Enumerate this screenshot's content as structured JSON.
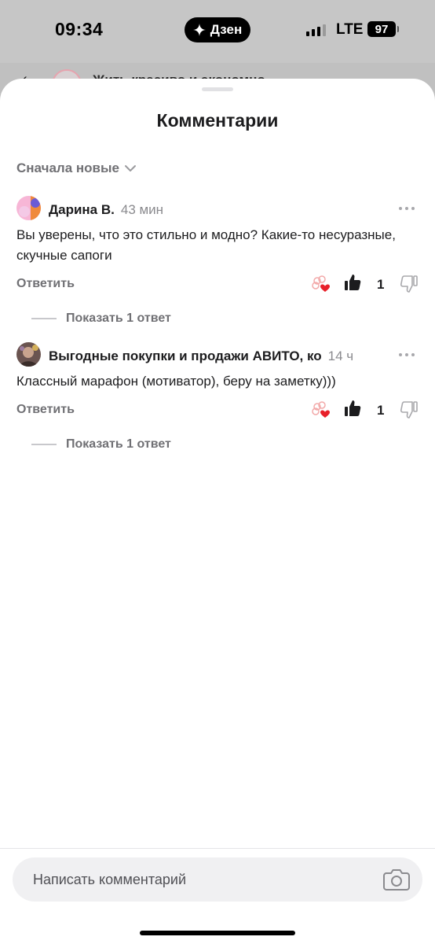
{
  "status_bar": {
    "time": "09:34",
    "app_pill": "Дзен",
    "network": "LTE",
    "battery": "97"
  },
  "background": {
    "title": "Жить красиво и экономно"
  },
  "sheet": {
    "title": "Комментарии",
    "sort_label": "Сначала новые"
  },
  "comments": [
    {
      "author": "Дарина В.",
      "time": "43 мин",
      "text": "Вы уверены, что это стильно и модно? Какие-то несуразные, скучные сапоги",
      "reply_label": "Ответить",
      "likes": "1",
      "show_replies": "Показать 1 ответ"
    },
    {
      "author": "Выгодные покупки и продажи АВИТО, ко",
      "time": "14 ч",
      "text": "Классный марафон (мотиватор), беру на заметку)))",
      "reply_label": "Ответить",
      "likes": "1",
      "show_replies": "Показать 1 ответ"
    }
  ],
  "composer": {
    "placeholder": "Написать комментарий"
  },
  "icons": [
    "sparkle-icon",
    "signal-icon",
    "battery-icon",
    "chevron-down-icon",
    "more-icon",
    "reaction-icon",
    "thumb-up-icon",
    "thumb-down-icon",
    "camera-icon"
  ],
  "colors": {
    "accent_heart": "#e8202a",
    "text_primary": "#1c1c1e",
    "text_secondary": "#707074"
  }
}
